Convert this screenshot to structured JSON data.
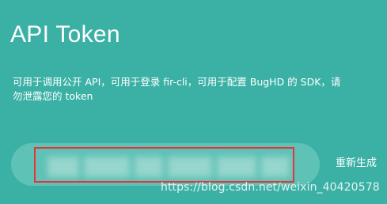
{
  "page": {
    "title": "API  Token",
    "description": "可用于调用公开 API，可用于登录 fir-cli，可用于配置 BugHD 的 SDK，请勿泄露您的 token"
  },
  "token": {
    "value": ""
  },
  "actions": {
    "regenerate_label": "重新生成"
  },
  "watermark": {
    "text": "https://blog.csdn.net/weixin_40420578"
  },
  "colors": {
    "background": "#3bb1a6",
    "token_field": "#5ec2b6",
    "highlight_border": "#e8343c",
    "text": "#ffffff"
  }
}
